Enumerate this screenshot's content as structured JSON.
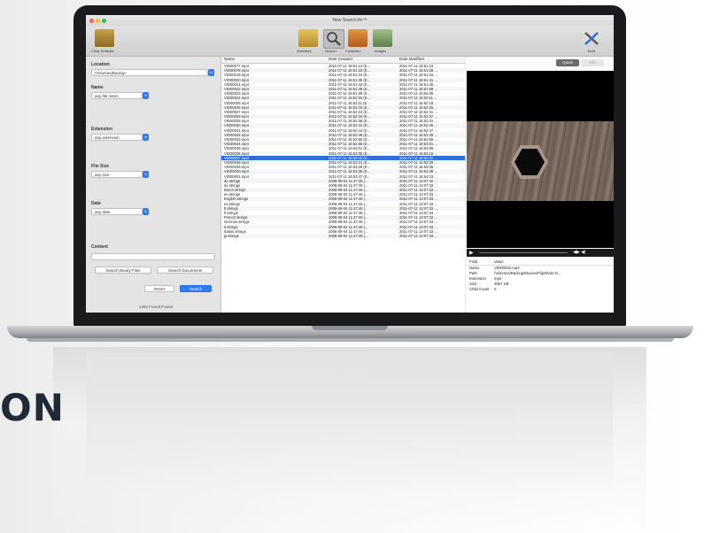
{
  "window": {
    "title": "New Search.fm™"
  },
  "toolbar": {
    "left_label": "Clear Defaults",
    "items": [
      "Aminates",
      "Search",
      "Collection",
      "Images"
    ],
    "right_label": "Tools"
  },
  "left_panel": {
    "location": {
      "label": "Location",
      "value": "/Volumes/Backup"
    },
    "name": {
      "label": "Name",
      "value": "any file name"
    },
    "extension": {
      "label": "Extension",
      "value": "any extension"
    },
    "file_size": {
      "label": "File Size",
      "value": "any size"
    },
    "date": {
      "label": "Date",
      "value": "any date"
    },
    "content": {
      "label": "Content",
      "value": ""
    },
    "search_binary": "Search Binary Files",
    "search_documents": "Search Documents",
    "reset": "Reset",
    "search": "Search",
    "status": "1463 Found Found"
  },
  "table": {
    "headers": [
      "Name",
      "Date Created",
      "Date Modified"
    ],
    "selected_index": 20,
    "rows": [
      [
        "VID00077.mp4",
        "2011-07-11 16:51:13 (E...",
        "2011-07-11 16:51:23 ..."
      ],
      [
        "VID00078.mp4",
        "2011-07-11 16:51:23 (E...",
        "2011-07-11 16:51:28 ..."
      ],
      [
        "VID00019.mp4",
        "2011-07-11 16:51:24 (E...",
        "2011-07-11 16:51:34 ..."
      ],
      [
        "VID00020.mp4",
        "2011-07-11 16:51:35 (E...",
        "2011-07-11 16:51:41 ..."
      ],
      [
        "VID00021.mp4",
        "2011-07-11 16:51:43 (E...",
        "2011-07-11 16:51:45 ..."
      ],
      [
        "VID00022.mp4",
        "2011-07-11 16:51:48 (E...",
        "2011-07-11 16:51:58 ..."
      ],
      [
        "VID00023.mp4",
        "2011-07-11 16:51:59 (E...",
        "2011-07-11 16:52:08 ..."
      ],
      [
        "VID00024.mp4",
        "2011-07-11 16:52:03 (E...",
        "2011-07-11 16:52:11 ..."
      ],
      [
        "VID00025.mp4",
        "2011-07-11 16:52:11 (E...",
        "2011-07-11 16:52:18 ..."
      ],
      [
        "VID00026.mp4",
        "2011-07-11 16:52:18 (E...",
        "2011-07-11 16:52:25 ..."
      ],
      [
        "VID00027.mp4",
        "2011-07-11 16:52:24 (E...",
        "2011-07-11 16:52:31 ..."
      ],
      [
        "VID00028.mp4",
        "2011-07-11 16:52:34 (E...",
        "2011-07-11 16:52:37 ..."
      ],
      [
        "VID00029.mp4",
        "2011-07-11 16:52:38 (E...",
        "2011-07-11 16:52:41 ..."
      ],
      [
        "VID00030.mp4",
        "2011-07-11 16:52:41 (E...",
        "2011-07-11 16:52:45 ..."
      ],
      [
        "VID00031.mp4",
        "2011-07-11 16:52:44 (E...",
        "2011-07-11 16:52:47 ..."
      ],
      [
        "VID00032.mp4",
        "2011-07-11 16:52:48 (E...",
        "2011-07-11 16:52:49 ..."
      ],
      [
        "VID00033.mp4",
        "2011-07-11 16:52:50 (E...",
        "2011-07-11 16:52:56 ..."
      ],
      [
        "VID00034.mp4",
        "2011-07-11 16:52:56 (E...",
        "2011-07-11 16:53:01 ..."
      ],
      [
        "VID00035.mp4",
        "2011-07-11 16:53:01 (E...",
        "2011-07-11 16:53:08 ..."
      ],
      [
        "VID00036.mp4",
        "2011-07-11 16:53:08 (E...",
        "2011-07-11 16:53:15 ..."
      ],
      [
        "VID00037.mp4",
        "2011-07-11 16:53:15 (E...",
        "2011-07-11 16:53:21 ..."
      ],
      [
        "VID00038.mp4",
        "2011-07-11 16:53:21 (E...",
        "2011-07-11 16:53:29 ..."
      ],
      [
        "VID00039.mp4",
        "2011-07-11 16:53:29 (E...",
        "2011-07-11 16:53:35 ..."
      ],
      [
        "VID00040.mp4",
        "2011-07-11 16:53:35 (E...",
        "2011-07-11 16:53:48 ..."
      ],
      [
        "VID00041.mp4",
        "2011-07-11 16:53:47 (E...",
        "2011-07-11 16:54:23 ..."
      ],
      [
        "de.strings",
        "2008-09-04 11:47:46 (...",
        "2011-07-11 13:07:32 ..."
      ],
      [
        "de.strings",
        "2008-09-04 11:47:46 (...",
        "2011-07-11 13:07:33 ..."
      ],
      [
        "Dutch.strings",
        "2008-09-04 11:47:46 (...",
        "2011-07-11 13:07:33 ..."
      ],
      [
        "en.strings",
        "2008-09-04 11:47:46 (...",
        "2011-07-11 13:07:33 ..."
      ],
      [
        "English.strings",
        "2008-09-04 11:47:46 (...",
        "2011-07-11 13:07:33 ..."
      ],
      [
        "es.strings",
        "2008-09-04 11:47:46 (...",
        "2011-07-11 13:07:33 ..."
      ],
      [
        "fr.strings",
        "2008-09-04 11:47:46 (...",
        "2011-07-11 13:07:33 ..."
      ],
      [
        "fr.strings",
        "2008-09-04 11:47:46 (...",
        "2011-07-11 13:07:33 ..."
      ],
      [
        "French.strings",
        "2008-09-04 11:47:46 (...",
        "2011-07-11 13:07:33 ..."
      ],
      [
        "German.strings",
        "2008-09-04 11:47:46 (...",
        "2011-07-11 13:07:33 ..."
      ],
      [
        "it.strings",
        "2008-09-04 11:47:46 (...",
        "2011-07-11 13:07:33 ..."
      ],
      [
        "Italian.strings",
        "2008-09-04 11:47:46 (...",
        "2011-07-11 13:07:33 ..."
      ],
      [
        "ja.strings",
        "2008-09-04 11:47:46 (...",
        "2011-07-11 13:07:33 ..."
      ]
    ]
  },
  "preview": {
    "seg_left": "Quick",
    "seg_right": "Info",
    "info_header": [
      "Field",
      "Value"
    ],
    "info_rows": [
      [
        "Name",
        "VID00032.mp4"
      ],
      [
        "Path",
        "/Volumes/Backup/Movies/FlipShare D..."
      ],
      [
        "Extension",
        "mp4"
      ],
      [
        "Size",
        "4657 KB"
      ],
      [
        "Child Count",
        "0"
      ]
    ]
  },
  "hero_text": "ON",
  "colors": {
    "accent": "#2f7cf6",
    "selection": "#2f6ed9",
    "hero": "#1f2a36"
  }
}
